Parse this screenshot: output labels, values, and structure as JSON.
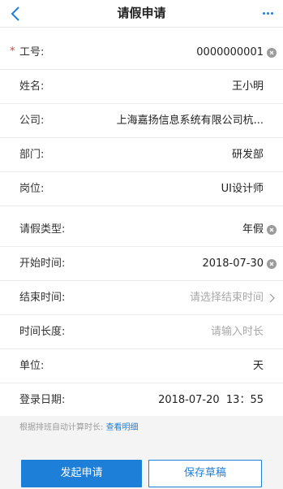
{
  "header": {
    "title": "请假申请",
    "back_icon": "chevron-left-icon",
    "more_icon": "more-dots-icon",
    "accent": "#1e7fd8"
  },
  "form": {
    "fields": [
      {
        "label": "工号:",
        "value": "0000000001",
        "required": true,
        "trailing": "clear-icon"
      },
      {
        "label": "姓名:",
        "value": "王小明"
      },
      {
        "label": "公司:",
        "value": "上海嘉扬信息系统有限公司杭..."
      },
      {
        "label": "部门:",
        "value": "研发部"
      },
      {
        "label": "岗位:",
        "value": "UI设计师"
      },
      {
        "label": "请假类型:",
        "value": "年假",
        "trailing": "clear-icon"
      },
      {
        "label": "开始时间:",
        "value": "2018-07-30",
        "trailing": "clear-icon"
      },
      {
        "label": "结束时间:",
        "placeholder": "请选择结束时间",
        "trailing": "chevron-right-icon"
      },
      {
        "label": "时间长度:",
        "placeholder": "请输入时长"
      },
      {
        "label": "单位:",
        "value": "天"
      },
      {
        "label": "登录日期:",
        "value": "2018-07-20  13：55"
      }
    ],
    "required_mark": "*"
  },
  "hint": {
    "text": "根据排班自动计算时长:",
    "link": "查看明细"
  },
  "actions": {
    "submit_label": "发起申请",
    "save_label": "保存草稿"
  }
}
